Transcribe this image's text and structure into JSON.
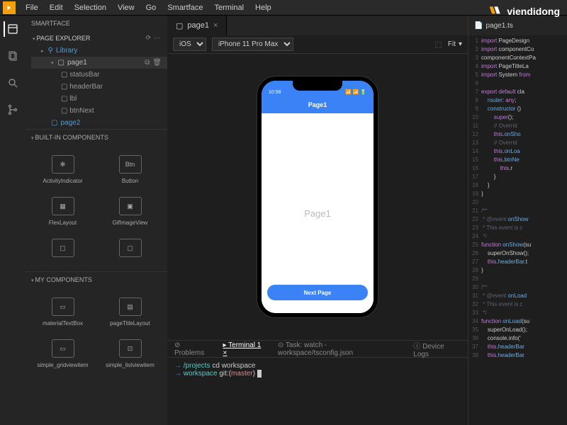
{
  "menu": [
    "File",
    "Edit",
    "Selection",
    "View",
    "Go",
    "Smartface",
    "Terminal",
    "Help"
  ],
  "brand": "viendidong",
  "sidebar": {
    "title": "SMARTFACE",
    "explorer": "PAGE EXPLORER",
    "library": "Library",
    "page1": "page1",
    "items": [
      "statusBar",
      "headerBar",
      "lbl",
      "btnNext"
    ],
    "page2": "page2",
    "builtin_title": "BUILT-IN COMPONENTS",
    "builtin": [
      "ActivityIndicator",
      "Button",
      "FlexLayout",
      "GifImageView",
      "",
      ""
    ],
    "mycomp_title": "MY COMPONENTS",
    "mycomp": [
      "materialTextBox",
      "pageTitleLayout",
      "simple_gridviewitem",
      "simple_listviewitem"
    ]
  },
  "tabs": {
    "page1": "page1"
  },
  "toolbar": {
    "os": "iOS",
    "device": "iPhone 11 Pro Max",
    "fit": "Fit"
  },
  "preview": {
    "time": "10:58",
    "title": "Page1",
    "body": "Page1",
    "button": "Next Page"
  },
  "bottom": {
    "tabs": [
      "Problems",
      "Terminal 1",
      "Task: watch - workspace/tsconfig.json",
      "Device Logs"
    ],
    "lines": [
      {
        "arrow": "→",
        "path": "/projects",
        "cmd": "cd workspace"
      },
      {
        "arrow": "→",
        "path": "workspace",
        "git": "git:(",
        "branch": "master",
        "git2": ")"
      }
    ]
  },
  "editor": {
    "tab": "page1.ts",
    "lines": [
      {
        "n": 1,
        "t": "import PageDesign"
      },
      {
        "n": 2,
        "t": "import componentCo"
      },
      {
        "n": 3,
        "t": "componentContextPa"
      },
      {
        "n": 4,
        "t": "import PageTitleLa"
      },
      {
        "n": 5,
        "t": "import System from"
      },
      {
        "n": 6,
        "t": ""
      },
      {
        "n": 7,
        "t": "export default cla"
      },
      {
        "n": 8,
        "t": "    router: any;"
      },
      {
        "n": 9,
        "t": "    constructor ()"
      },
      {
        "n": 10,
        "t": "        super();"
      },
      {
        "n": 11,
        "t": "        // Overrid"
      },
      {
        "n": 12,
        "t": "        this.onSho"
      },
      {
        "n": 13,
        "t": "        // Overrid"
      },
      {
        "n": 14,
        "t": "        this.onLoa"
      },
      {
        "n": 15,
        "t": "        this.btnNe"
      },
      {
        "n": 16,
        "t": "            this.r"
      },
      {
        "n": 17,
        "t": "        }"
      },
      {
        "n": 18,
        "t": "    }"
      },
      {
        "n": 19,
        "t": "}"
      },
      {
        "n": 20,
        "t": ""
      },
      {
        "n": 21,
        "t": "/**"
      },
      {
        "n": 22,
        "t": " * @event onShow"
      },
      {
        "n": 23,
        "t": " * This event is c"
      },
      {
        "n": 24,
        "t": " */"
      },
      {
        "n": 25,
        "t": "function onShow(su"
      },
      {
        "n": 26,
        "t": "    superOnShow();"
      },
      {
        "n": 27,
        "t": "    this.headerBar.t"
      },
      {
        "n": 28,
        "t": "}"
      },
      {
        "n": 29,
        "t": ""
      },
      {
        "n": 30,
        "t": "/**"
      },
      {
        "n": 31,
        "t": " * @event onLoad"
      },
      {
        "n": 32,
        "t": " * This event is c"
      },
      {
        "n": 33,
        "t": " */"
      },
      {
        "n": 34,
        "t": "function onLoad(su"
      },
      {
        "n": 35,
        "t": "    superOnLoad();"
      },
      {
        "n": 36,
        "t": "    console.info('"
      },
      {
        "n": 37,
        "t": "    this.headerBar"
      },
      {
        "n": 38,
        "t": "    this.headerBar"
      }
    ]
  }
}
